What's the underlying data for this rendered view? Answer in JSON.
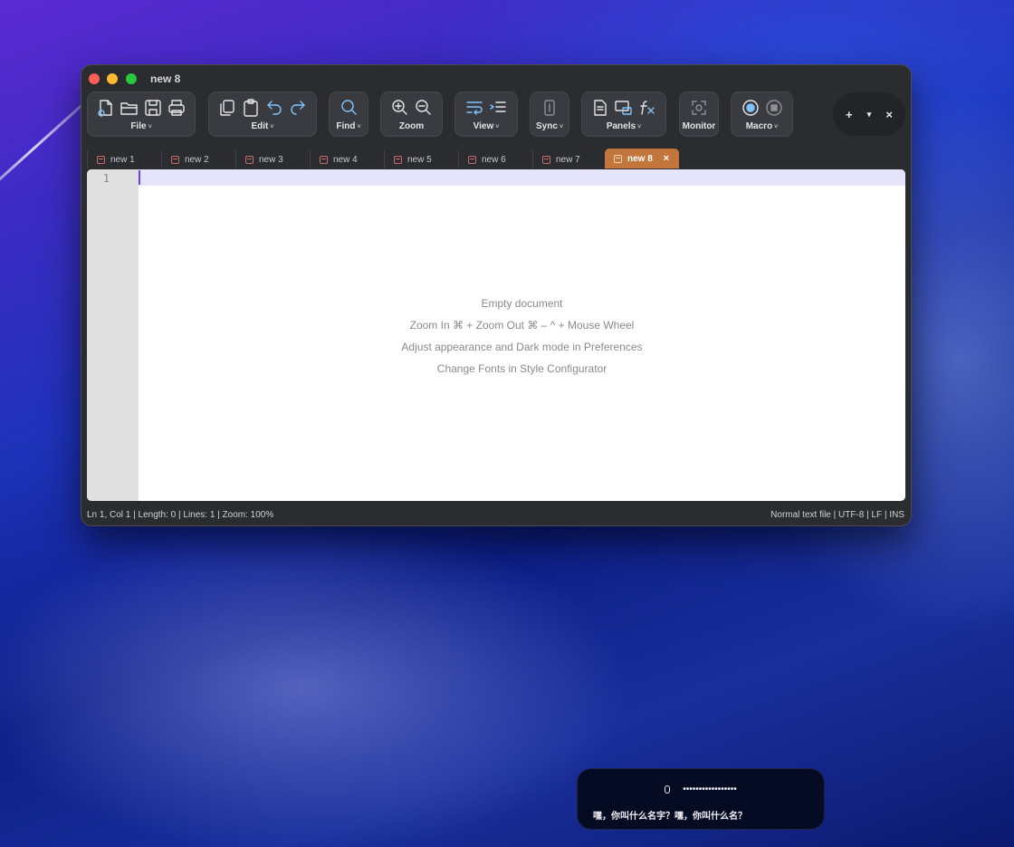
{
  "window": {
    "title": "new 8"
  },
  "toolbar": {
    "file": "File",
    "edit": "Edit",
    "find": "Find",
    "zoom": "Zoom",
    "view": "View",
    "sync": "Sync",
    "panels": "Panels",
    "monitor": "Monitor",
    "macro": "Macro",
    "chevron": "˅",
    "plus": "+",
    "dropdown": "▾",
    "close": "×"
  },
  "tabs": [
    {
      "label": "new 1"
    },
    {
      "label": "new 2"
    },
    {
      "label": "new 3"
    },
    {
      "label": "new 4"
    },
    {
      "label": "new 5"
    },
    {
      "label": "new 6"
    },
    {
      "label": "new 7"
    },
    {
      "label": "new 8",
      "close": "×"
    }
  ],
  "editor": {
    "line_number": "1",
    "hints": [
      "Empty document",
      "Zoom In  ⌘ +      Zoom Out  ⌘ –      ^ + Mouse Wheel",
      "Adjust appearance and Dark mode in Preferences",
      "Change Fonts in Style Configurator"
    ]
  },
  "status": {
    "left": "Ln 1, Col 1  |  Length: 0  |  Lines: 1  |  Zoom: 100%",
    "right": "Normal text file  |  UTF-8  |  LF  |  INS"
  },
  "caption": {
    "dots": "•••••••••••••••••",
    "text": "嘿，你叫什么名字？嘿，你叫什么名？"
  },
  "colors": {
    "active_tab": "#c2763c",
    "caret": "#6a3ff0",
    "current_line": "#e6e4fb"
  }
}
